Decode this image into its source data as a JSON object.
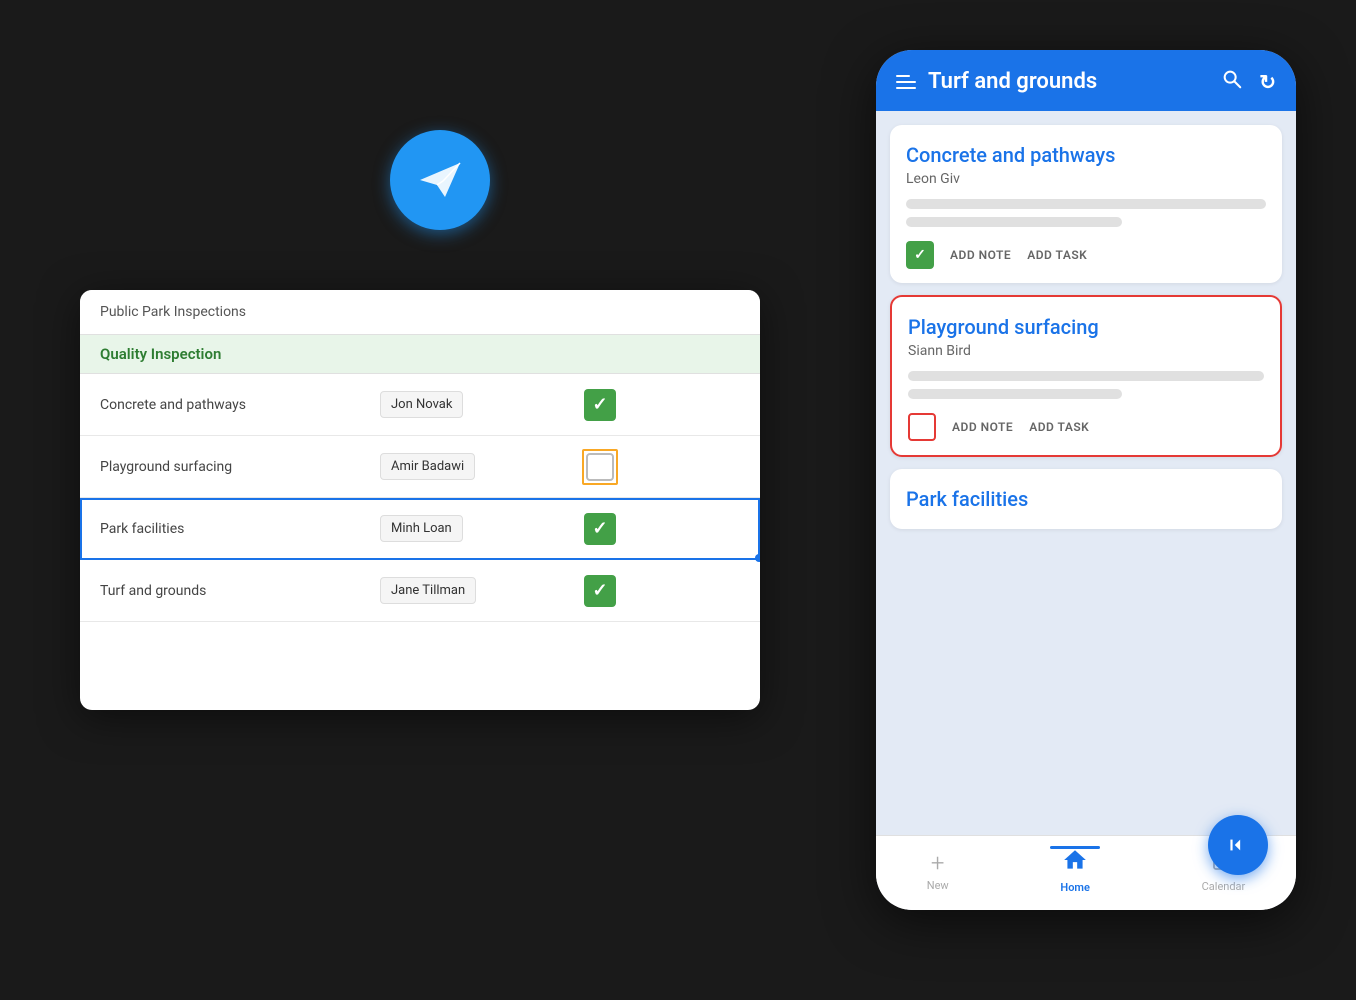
{
  "app": {
    "plane_icon": "✈",
    "background_color": "#1a1a1a"
  },
  "spreadsheet": {
    "title": "Public Park Inspections",
    "section_header": "Quality Inspection",
    "rows": [
      {
        "name": "Concrete and pathways",
        "person": "Jon Novak",
        "checked": true,
        "selected": false,
        "yellow_border": false
      },
      {
        "name": "Playground surfacing",
        "person": "Amir Badawi",
        "checked": false,
        "selected": false,
        "yellow_border": true
      },
      {
        "name": "Park facilities",
        "person": "Minh Loan",
        "checked": true,
        "selected": true,
        "yellow_border": false
      },
      {
        "name": "Turf and grounds",
        "person": "Jane Tillman",
        "checked": true,
        "selected": false,
        "yellow_border": false
      }
    ]
  },
  "phone": {
    "header": {
      "title": "Turf and grounds",
      "search_icon": "🔍",
      "refresh_icon": "↻"
    },
    "cards": [
      {
        "id": "card-concrete",
        "title": "Concrete and pathways",
        "subtitle": "Leon Giv",
        "checked": true,
        "selected_red": false,
        "actions": {
          "add_note": "ADD NOTE",
          "add_task": "ADD TASK"
        }
      },
      {
        "id": "card-playground",
        "title": "Playground surfacing",
        "subtitle": "Siann Bird",
        "checked": false,
        "selected_red": true,
        "actions": {
          "add_note": "ADD NOTE",
          "add_task": "ADD TASK"
        }
      },
      {
        "id": "card-park",
        "title": "Park facilities",
        "subtitle": "",
        "checked": false,
        "selected_red": false,
        "actions": {
          "add_note": "",
          "add_task": ""
        }
      }
    ],
    "bottom_nav": {
      "items": [
        {
          "label": "New",
          "icon": "+",
          "active": false
        },
        {
          "label": "Home",
          "icon": "⌂",
          "active": true
        },
        {
          "label": "Calendar",
          "icon": "📅",
          "active": false
        }
      ]
    }
  }
}
